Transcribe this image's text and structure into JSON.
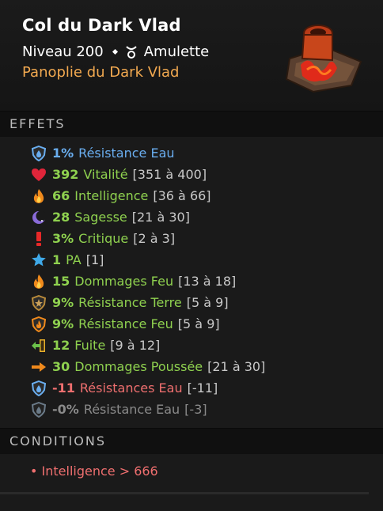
{
  "item": {
    "name": "Col du Dark Vlad",
    "level": "Niveau 200",
    "type": "Amulette",
    "set": "Panoplie du Dark Vlad"
  },
  "sections": {
    "effects": "EFFETS",
    "conditions": "CONDITIONS"
  },
  "effects": [
    {
      "icon": "water-shield-icon",
      "value": "1%",
      "label": "Résistance Eau",
      "range": "",
      "color": "blue"
    },
    {
      "icon": "heart-icon",
      "value": "392",
      "label": "Vitalité",
      "range": "[351 à 400]",
      "color": "green"
    },
    {
      "icon": "fire-icon",
      "value": "66",
      "label": "Intelligence",
      "range": "[36 à 66]",
      "color": "green"
    },
    {
      "icon": "moon-icon",
      "value": "28",
      "label": "Sagesse",
      "range": "[21 à 30]",
      "color": "green"
    },
    {
      "icon": "exclamation-icon",
      "value": "3%",
      "label": "Critique",
      "range": "[2 à 3]",
      "color": "green"
    },
    {
      "icon": "star-icon",
      "value": "1",
      "label": "PA",
      "range": "[1]",
      "color": "green"
    },
    {
      "icon": "fire-icon",
      "value": "15",
      "label": "Dommages Feu",
      "range": "[13 à 18]",
      "color": "green"
    },
    {
      "icon": "earth-shield-icon",
      "value": "9%",
      "label": "Résistance Terre",
      "range": "[5 à 9]",
      "color": "green"
    },
    {
      "icon": "fire-shield-icon",
      "value": "9%",
      "label": "Résistance Feu",
      "range": "[5 à 9]",
      "color": "green"
    },
    {
      "icon": "escape-icon",
      "value": "12",
      "label": "Fuite",
      "range": "[9 à 12]",
      "color": "green"
    },
    {
      "icon": "arrow-right-icon",
      "value": "30",
      "label": "Dommages Poussée",
      "range": "[21 à 30]",
      "color": "green"
    },
    {
      "icon": "water-shield-icon",
      "value": "-11",
      "label": "Résistances Eau",
      "range": "[-11]",
      "color": "red"
    },
    {
      "icon": "water-shield-icon",
      "value": "-0%",
      "label": "Résistance Eau",
      "range": "[-3]",
      "color": "grey"
    }
  ],
  "conditions": [
    "• Intelligence > 666"
  ],
  "colors": {
    "green": "#8fd14f",
    "blue": "#6aaef0",
    "red": "#ef6f6f",
    "grey": "#8a8a8a",
    "set": "#f2a950"
  }
}
